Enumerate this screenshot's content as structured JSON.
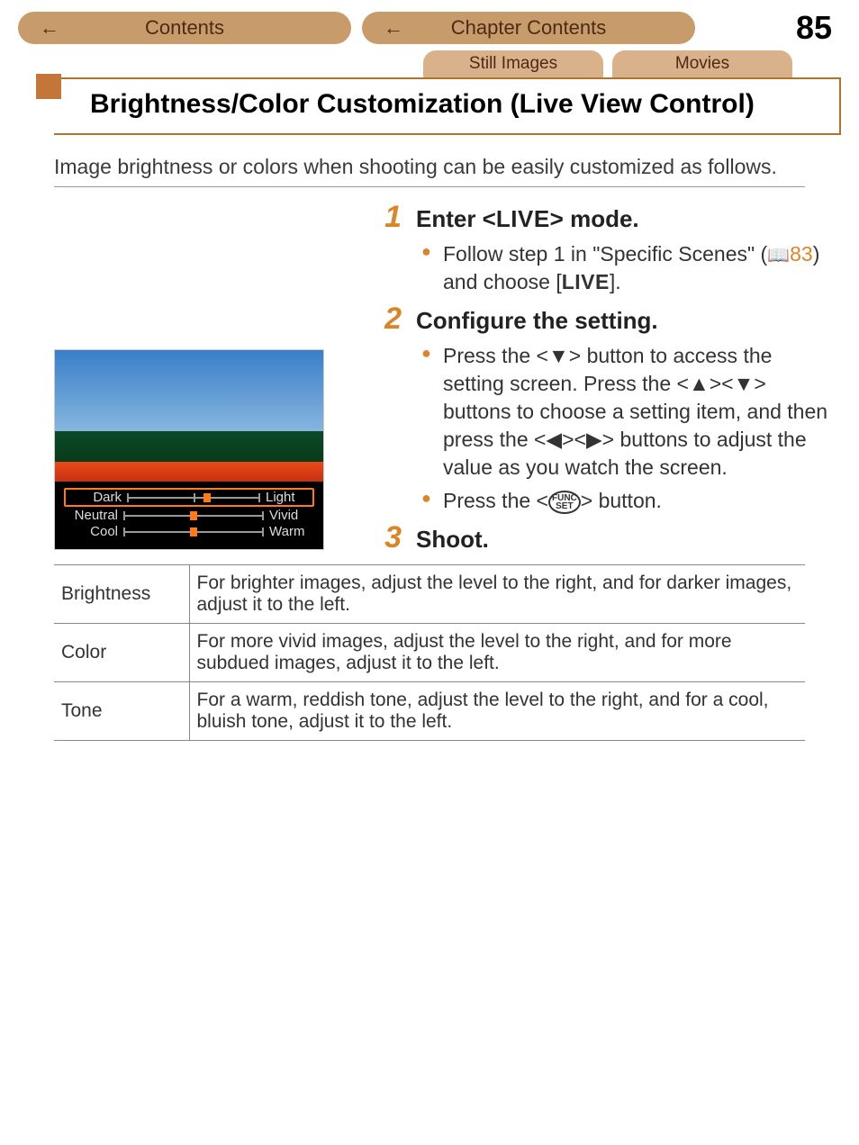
{
  "nav": {
    "contents": "Contents",
    "chapter": "Chapter Contents",
    "page": "85"
  },
  "tabs": {
    "still": "Still Images",
    "movies": "Movies"
  },
  "heading": "Brightness/Color Customization (Live View Control)",
  "intro": "Image brightness or colors when shooting can be easily customized as follows.",
  "steps": {
    "s1": {
      "num": "1",
      "title": "Enter <LIVE> mode.",
      "b1a": "Follow step 1 in \"Specific Scenes\" (",
      "b1ref": "83",
      "b1b": ") and choose [",
      "b1live": "LIVE",
      "b1c": "]."
    },
    "s2": {
      "num": "2",
      "title": "Configure the setting.",
      "b1": "Press the <▼> button to access the setting screen. Press the <▲><▼> buttons to choose a setting item, and then press the <◀><▶> buttons to adjust the value as you watch the screen.",
      "b2a": "Press the <",
      "b2func1": "FUNC",
      "b2func2": "SET",
      "b2b": "> button."
    },
    "s3": {
      "num": "3",
      "title": "Shoot."
    }
  },
  "preview": {
    "row1": {
      "left": "Dark",
      "right": "Light"
    },
    "row2": {
      "left": "Neutral",
      "right": "Vivid"
    },
    "row3": {
      "left": "Cool",
      "right": "Warm"
    }
  },
  "table": {
    "r1": {
      "k": "Brightness",
      "v": "For brighter images, adjust the level to the right, and for darker images, adjust it to the left."
    },
    "r2": {
      "k": "Color",
      "v": "For more vivid images, adjust the level to the right, and for more subdued images, adjust it to the left."
    },
    "r3": {
      "k": "Tone",
      "v": "For a warm, reddish tone, adjust the level to the right, and for a cool, bluish tone, adjust it to the left."
    }
  }
}
